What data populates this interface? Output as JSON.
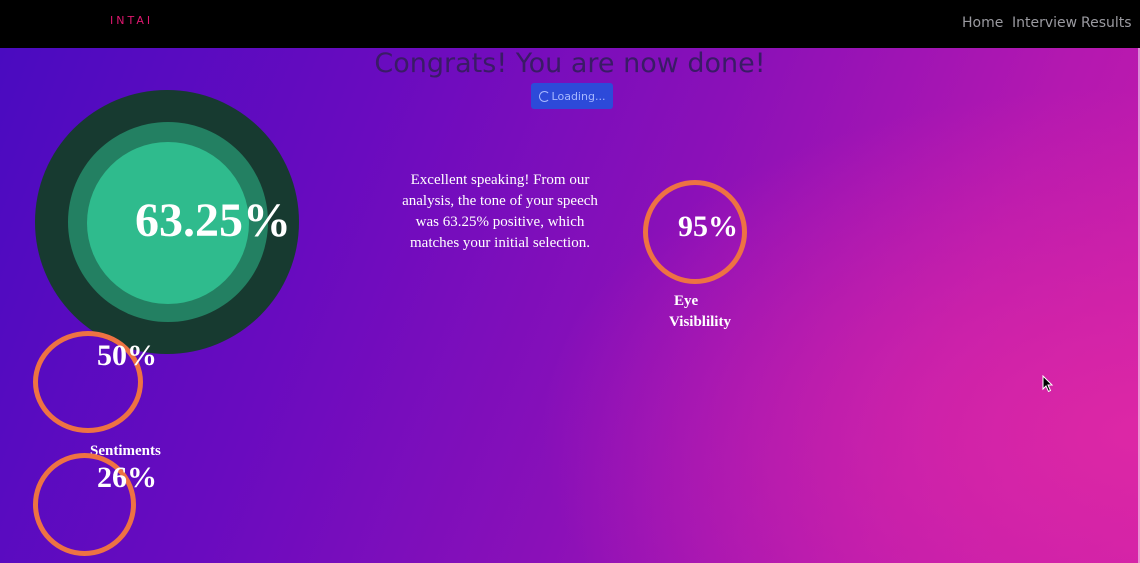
{
  "nav": {
    "brand": "INTAI",
    "links": [
      "Home",
      "Interview",
      "Results"
    ]
  },
  "main": {
    "title": "Congrats! You are now done!",
    "loading_label": "Loading...",
    "tone_score": "63.25%",
    "message": "Excellent speaking! From our analysis, the tone of your speech was 63.25% positive, which matches your initial selection.",
    "metrics": [
      {
        "value": "50%",
        "label": ""
      },
      {
        "value": "26%",
        "label": "Sentiments"
      },
      {
        "value": "95%",
        "label": "Eye Visiblility"
      }
    ]
  },
  "colors": {
    "navbar": "#000000",
    "brand": "#e0176f",
    "ring_dark": "#173a30",
    "ring_mid": "#238062",
    "ring_light": "#2fbb8d",
    "metric_ring": "#ee7243",
    "button": "#2d4ad9",
    "gradient_start": "#4a0bc0",
    "gradient_end": "#c81caa"
  },
  "icons": [
    "spinner-icon",
    "mouse-cursor-icon"
  ]
}
